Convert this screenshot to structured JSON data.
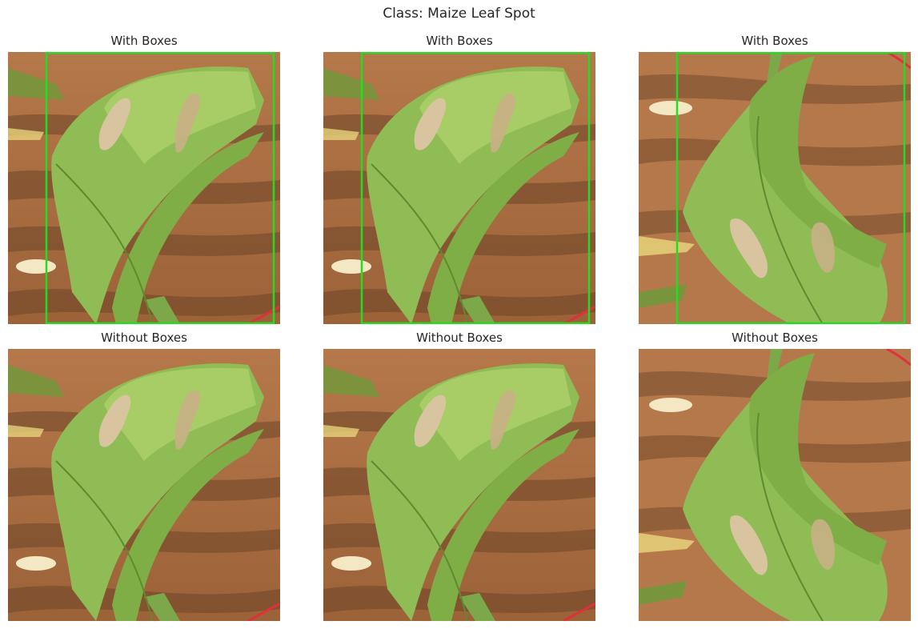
{
  "figure": {
    "title": "Class: Maize Leaf Spot",
    "panels": [
      {
        "title": "With Boxes",
        "variant": "a",
        "boxes": true
      },
      {
        "title": "With Boxes",
        "variant": "a",
        "boxes": true
      },
      {
        "title": "With Boxes",
        "variant": "b",
        "boxes": true
      },
      {
        "title": "Without Boxes",
        "variant": "a",
        "boxes": false
      },
      {
        "title": "Without Boxes",
        "variant": "a",
        "boxes": false
      },
      {
        "title": "Without Boxes",
        "variant": "b",
        "boxes": false
      }
    ],
    "box_color": "#22dd22",
    "colors": {
      "soil": "#b5784a",
      "soil_dark": "#6e4528",
      "leaf": "#8fbc55",
      "leaf_light": "#b4d46e",
      "lesion": "#d9c4a0",
      "rope": "#e0303c"
    }
  }
}
